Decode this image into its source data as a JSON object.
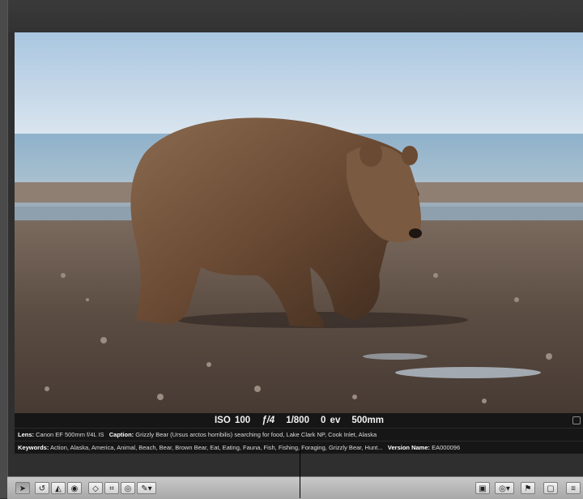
{
  "exif": {
    "iso": "ISO 100",
    "aperture": "ƒ/4",
    "shutter": "1/800",
    "exposure": "0 ev",
    "focal_length": "500mm"
  },
  "metadata": {
    "lens_label": "Lens:",
    "lens_value": "Canon EF 500mm f/4L IS",
    "caption_label": "Caption:",
    "caption_value": "Grizzly Bear (Ursus arctos horribilis) searching for food, Lake Clark NP, Cook Inlet, Alaska",
    "keywords_label": "Keywords:",
    "keywords_value": "Action, Alaska, America, Animal, Beach, Bear, Brown Bear, Eat, Eating, Fauna, Fish, Fishing, Foraging, Grizzly Bear, Hunt...",
    "version_label": "Version Name:",
    "version_value": "EA000096"
  },
  "toolbar": {
    "left_tools": [
      "pointer-icon",
      "rotate-icon",
      "straighten-icon",
      "lift-stamp-icon",
      "flatten-icon",
      "crop-icon",
      "red-eye-icon",
      "brush-icon"
    ],
    "right_tools": [
      "viewer-mode-icon",
      "loupe-icon",
      "flag-icon",
      "panel-icon",
      "list-icon"
    ]
  },
  "photo": {
    "subject": "grizzly bear on beach",
    "colors": {
      "sky": "#b8d1e6",
      "water": "#7fa2bf",
      "sand": "#6b5b4e",
      "bear": "#6b4a33"
    }
  }
}
